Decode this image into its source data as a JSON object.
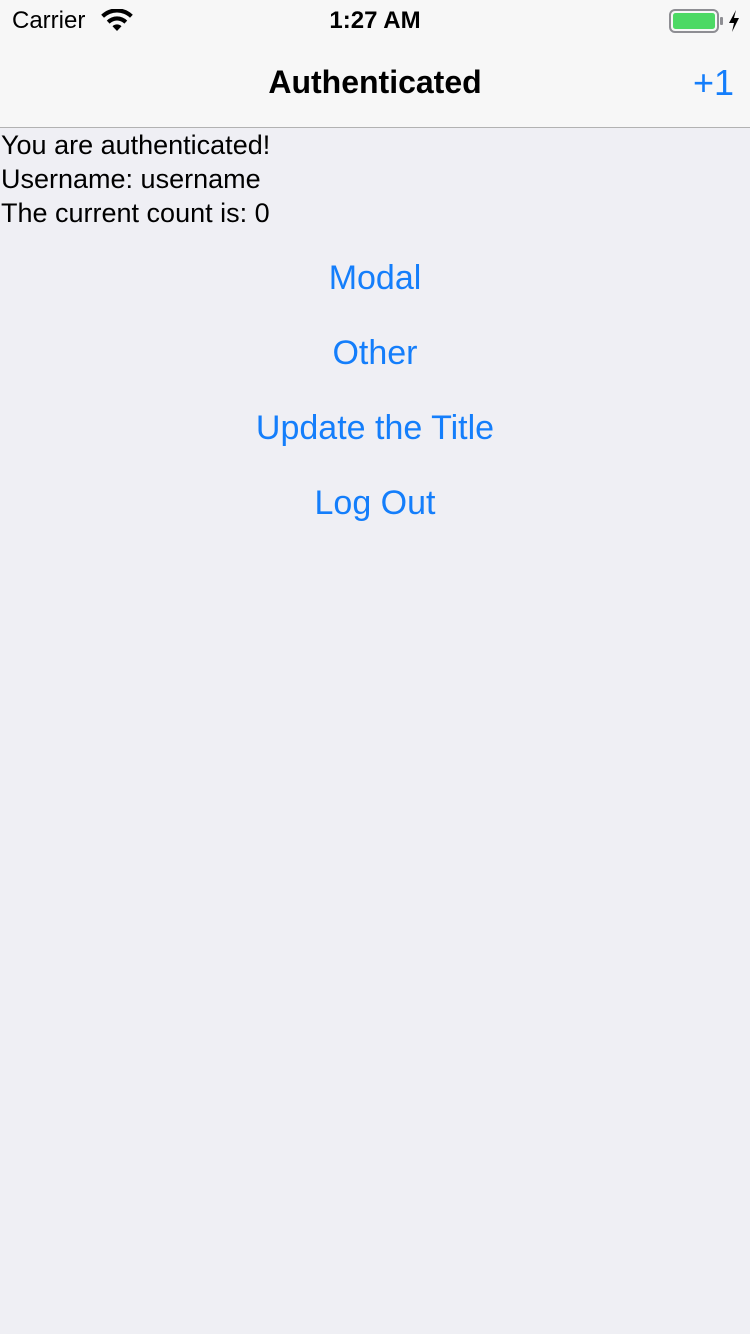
{
  "status_bar": {
    "carrier": "Carrier",
    "time": "1:27 AM",
    "battery_color": "#4cd964"
  },
  "nav": {
    "title": "Authenticated",
    "right_button": "+1"
  },
  "info": {
    "line1": "You are authenticated!",
    "line2": "Username: username",
    "line3": "The current count is: 0"
  },
  "buttons": {
    "modal": "Modal",
    "other": "Other",
    "update_title": "Update the Title",
    "log_out": "Log Out"
  },
  "colors": {
    "accent": "#147efb",
    "background": "#efeff4",
    "bar_background": "#f7f7f7"
  }
}
